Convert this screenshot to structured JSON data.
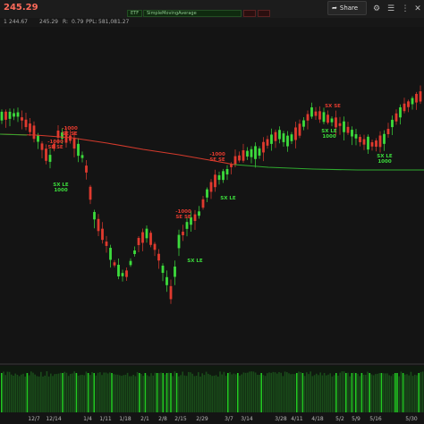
{
  "header": {
    "last_price": "245.29",
    "quote_fields": [
      "1",
      "244.67",
      "245.29",
      "R:",
      "0.79",
      "PPL:",
      "581,081.27"
    ],
    "study_labels": [
      "ETF",
      "SimpleMovingAverage"
    ],
    "share_label": "Share",
    "icons": [
      "gear-icon",
      "sliders-icon",
      "more-icon",
      "close-icon"
    ]
  },
  "colors": {
    "up": "#3cdc3c",
    "down": "#e03a2e",
    "ma_above": "#d43a2c",
    "ma_below": "#2faa2f",
    "volume": "#22c922",
    "background": "#141414"
  },
  "chart_data": {
    "type": "candlestick",
    "x_tick_labels": [
      "12/7",
      "12/14",
      "1/4",
      "1/11",
      "1/18",
      "2/1",
      "2/8",
      "2/15",
      "2/29",
      "3/7",
      "3/14",
      "3/28",
      "4/11",
      "4/18",
      "5/2",
      "5/9",
      "5/16",
      "5/30"
    ],
    "signals": [
      {
        "label": "-1000",
        "sub": "SE SE",
        "type": "sell"
      },
      {
        "label": "-1000",
        "sub": "SE SE",
        "type": "sell"
      },
      {
        "label": "SX LE",
        "sub": "1000",
        "type": "buy"
      },
      {
        "label": "-1000",
        "sub": "SE SE",
        "type": "sell"
      },
      {
        "label": "SX LE",
        "sub": "",
        "type": "buy"
      },
      {
        "label": "-1000",
        "sub": "SE SE",
        "type": "sell"
      },
      {
        "label": "SX LE",
        "sub": "",
        "type": "buy"
      },
      {
        "label": "",
        "sub": "SX SE",
        "type": "sell"
      },
      {
        "label": "SX LE",
        "sub": "1000",
        "type": "buy"
      },
      {
        "label": "SX LE",
        "sub": "1000",
        "type": "buy"
      }
    ]
  }
}
